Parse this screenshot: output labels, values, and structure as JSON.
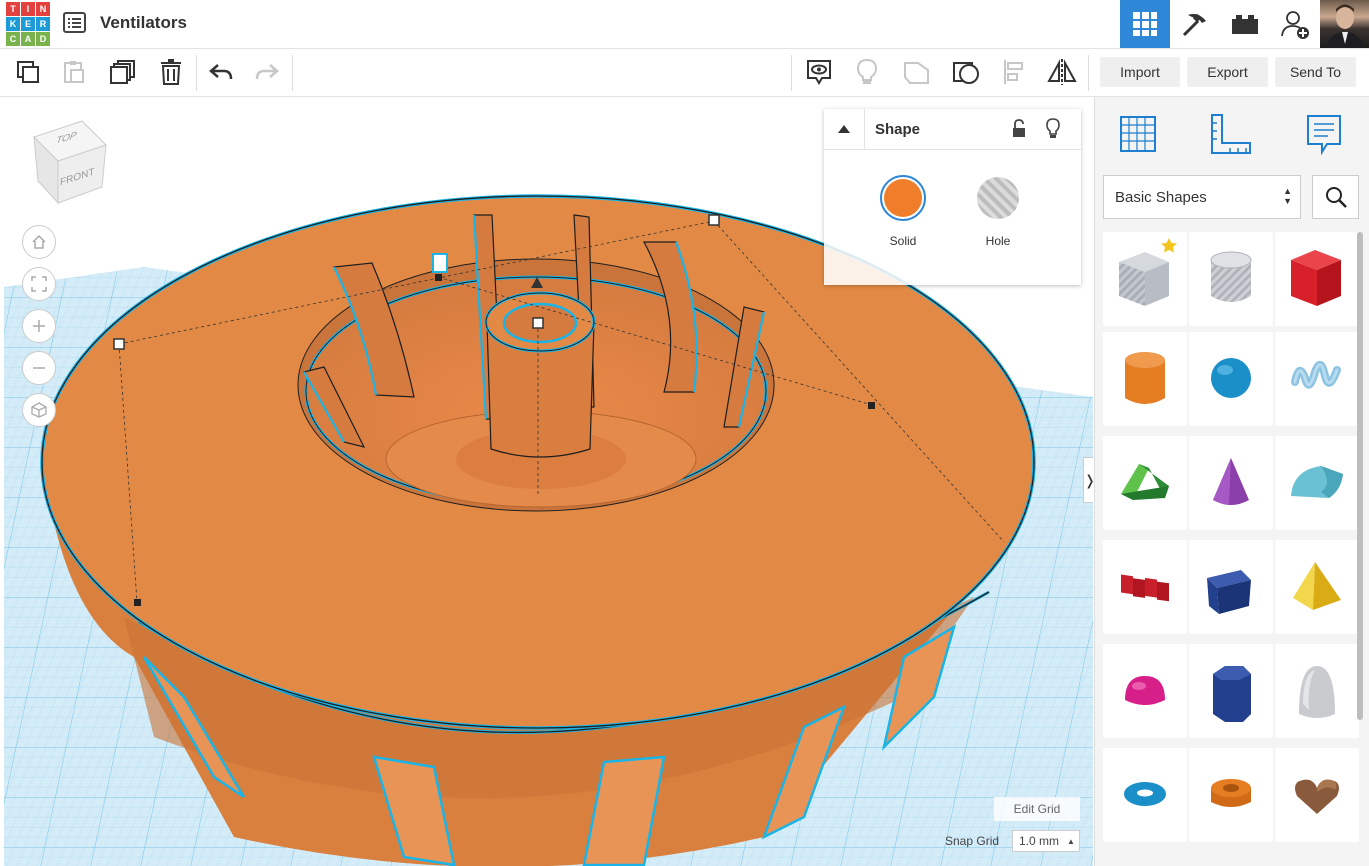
{
  "app": {
    "logo_letters": [
      "T",
      "I",
      "N",
      "K",
      "E",
      "R",
      "C",
      "A",
      "D"
    ],
    "logo_colors": [
      "#e2413e",
      "#e2413e",
      "#e2413e",
      "#1d9bd6",
      "#1d9bd6",
      "#1d9bd6",
      "#7ab24c",
      "#7ab24c",
      "#7ab24c"
    ],
    "title": "Ventilators"
  },
  "topbar": {
    "icons": [
      "grid-view-icon",
      "pickaxe-icon",
      "bricks-icon",
      "add-user-icon",
      "avatar"
    ],
    "active_color": "#2f87d8"
  },
  "toolbar": {
    "import_label": "Import",
    "export_label": "Export",
    "send_to_label": "Send To"
  },
  "viewcube": {
    "top": "TOP",
    "front": "FRONT"
  },
  "inspector": {
    "title": "Shape",
    "solid_label": "Solid",
    "hole_label": "Hole",
    "solid_color": "#ef7d2a"
  },
  "library": {
    "category": "Basic Shapes",
    "shapes": [
      {
        "name": "box-hole",
        "color": "#b8bcc4"
      },
      {
        "name": "cylinder-hole",
        "color": "#c4c6cc"
      },
      {
        "name": "box",
        "color": "#d7202a"
      },
      {
        "name": "cylinder",
        "color": "#e57d23"
      },
      {
        "name": "sphere",
        "color": "#1b8fc8"
      },
      {
        "name": "scribble",
        "color": "#8ec4e2"
      },
      {
        "name": "roof",
        "color": "#3aa344"
      },
      {
        "name": "cone",
        "color": "#8b3fa8"
      },
      {
        "name": "round-roof",
        "color": "#6bc1d4"
      },
      {
        "name": "text",
        "color": "#c8202a"
      },
      {
        "name": "wedge-box",
        "color": "#22408d"
      },
      {
        "name": "pyramid",
        "color": "#e9c32a"
      },
      {
        "name": "half-sphere",
        "color": "#d71f8a"
      },
      {
        "name": "polygon",
        "color": "#22408d"
      },
      {
        "name": "paraboloid",
        "color": "#c9cbce"
      },
      {
        "name": "torus",
        "color": "#1b8fc8"
      },
      {
        "name": "tube",
        "color": "#e57d23"
      },
      {
        "name": "heart",
        "color": "#8a5a3c"
      }
    ]
  },
  "grid": {
    "edit_grid_label": "Edit Grid",
    "snap_grid_label": "Snap Grid",
    "snap_value": "1.0 mm"
  },
  "model_color": "#e28a45",
  "selection_color": "#19b4e8"
}
